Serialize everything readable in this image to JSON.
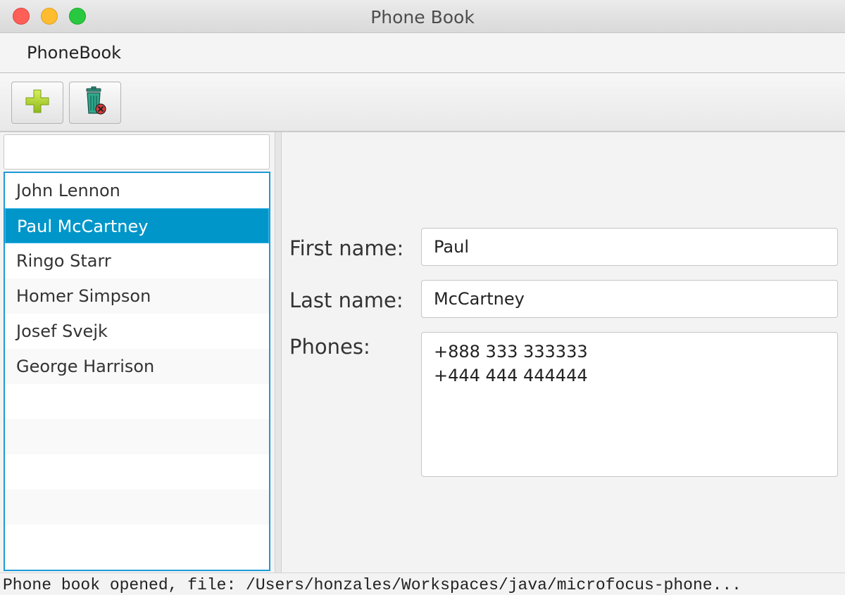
{
  "window": {
    "title": "Phone Book"
  },
  "menu": {
    "items": [
      "PhoneBook"
    ]
  },
  "toolbar": {
    "add_icon": "plus-icon",
    "delete_icon": "trash-icon"
  },
  "search": {
    "value": "",
    "placeholder": ""
  },
  "contacts": [
    {
      "name": "John Lennon",
      "selected": false
    },
    {
      "name": "Paul McCartney",
      "selected": true
    },
    {
      "name": "Ringo Starr",
      "selected": false
    },
    {
      "name": "Homer Simpson",
      "selected": false
    },
    {
      "name": "Josef Svejk",
      "selected": false
    },
    {
      "name": "George Harrison",
      "selected": false
    }
  ],
  "details": {
    "first_name_label": "First name:",
    "first_name_value": "Paul",
    "last_name_label": "Last name:",
    "last_name_value": "McCartney",
    "phones_label": "Phones:",
    "phones": [
      "+888 333 333333",
      "+444 444 444444"
    ]
  },
  "status": {
    "text": "Phone book opened, file: /Users/honzales/Workspaces/java/microfocus-phone..."
  },
  "colors": {
    "selection": "#0096c9",
    "list_border": "#1c9ad6"
  }
}
